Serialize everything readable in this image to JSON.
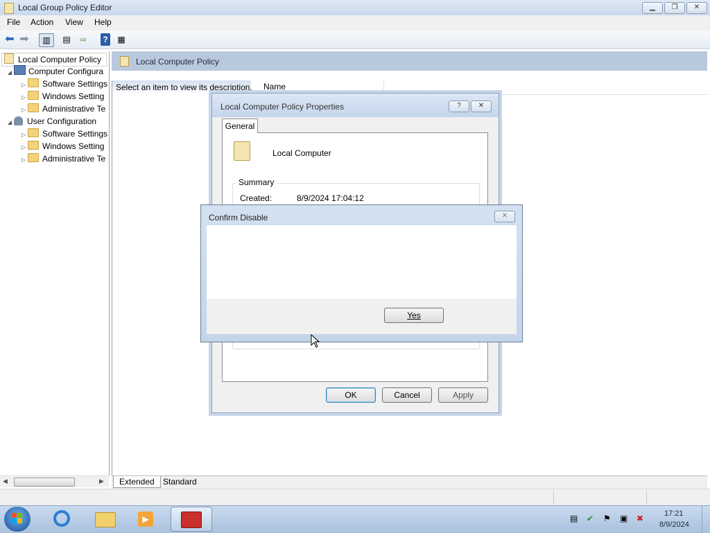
{
  "window": {
    "title": "Local Group Policy Editor"
  },
  "menu": [
    {
      "label": "File",
      "key": "F"
    },
    {
      "label": "Action",
      "key": "A"
    },
    {
      "label": "View",
      "key": "V"
    },
    {
      "label": "Help",
      "key": "H"
    }
  ],
  "toolbar": {
    "icons": [
      "back-icon",
      "forward-icon",
      "show-hide-tree-icon",
      "properties-icon",
      "export-list-icon",
      "help-icon",
      "console-tree-icon"
    ]
  },
  "tree": {
    "root": "Local Computer Policy",
    "computer": "Computer Configura",
    "computer_children": [
      "Software Settings",
      "Windows Setting",
      "Administrative Te"
    ],
    "user": "User Configuration",
    "user_children": [
      "Software Settings",
      "Windows Setting",
      "Administrative Te"
    ]
  },
  "right": {
    "header": "Local Computer Policy",
    "description": "Select an item to view its description.",
    "column_name": "Name",
    "tabs": [
      "Extended",
      "Standard"
    ]
  },
  "props_dialog": {
    "title": "Local Computer Policy Properties",
    "help_btn": "?",
    "close_btn": "✕",
    "tab": "General",
    "computer_label": "Local Computer",
    "summary_label": "Summary",
    "created_label": "Created:",
    "created_value": "8/9/2024 17:04:12",
    "ok": "OK",
    "cancel": "Cancel",
    "apply": "Apply"
  },
  "confirm_dialog": {
    "title": "Confirm Disable",
    "close_btn": "✕",
    "yes": "Yes"
  },
  "taskbar": {
    "time": "17:21",
    "date": "8/9/2024"
  },
  "colors": {
    "accent": "#1f5fb4",
    "taskbar": "#b8cce4"
  }
}
